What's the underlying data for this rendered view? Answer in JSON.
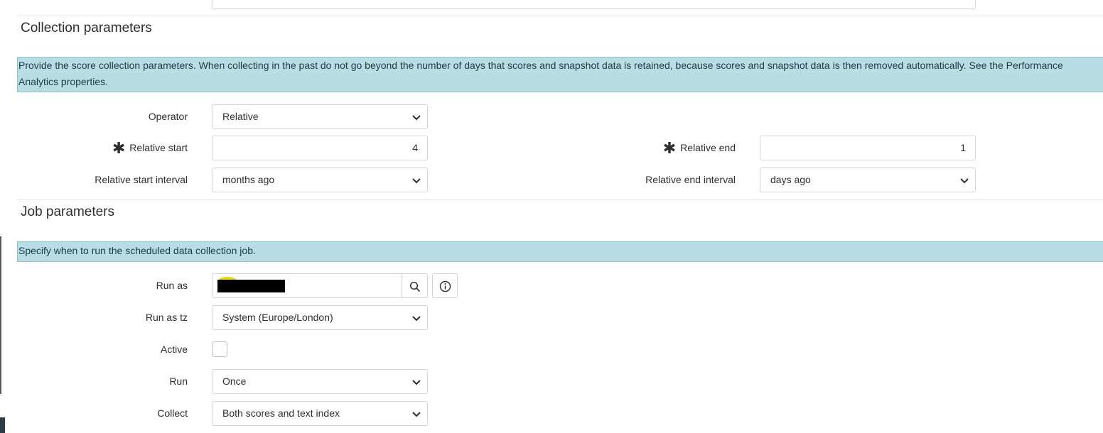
{
  "collection": {
    "title": "Collection parameters",
    "info": "Provide the score collection parameters. When collecting in the past do not go beyond the number of days that scores and snapshot data is retained, because scores and snapshot data is then removed automatically. See the Performance Analytics properties.",
    "operator": {
      "label": "Operator",
      "value": "Relative"
    },
    "relative_start": {
      "label": "Relative start",
      "value": "4",
      "required": true
    },
    "relative_end": {
      "label": "Relative end",
      "value": "1",
      "required": true
    },
    "relative_start_interval": {
      "label": "Relative start interval",
      "value": "months ago"
    },
    "relative_end_interval": {
      "label": "Relative end interval",
      "value": "days ago"
    }
  },
  "job": {
    "title": "Job parameters",
    "info": "Specify when to run the scheduled data collection job.",
    "run_as": {
      "label": "Run as",
      "value_redacted": true
    },
    "run_as_tz": {
      "label": "Run as tz",
      "value": "System (Europe/London)"
    },
    "active": {
      "label": "Active",
      "checked": false
    },
    "run": {
      "label": "Run",
      "value": "Once"
    },
    "collect": {
      "label": "Collect",
      "value": "Both scores and text index"
    }
  },
  "icons": {
    "chevron": "chevron-down-icon",
    "search": "search-icon",
    "info": "info-icon",
    "required": "asterisk-icon"
  },
  "colors": {
    "info_background": "#b8dde5",
    "field_border": "#cfd5d8",
    "text": "#2e2e2e"
  }
}
